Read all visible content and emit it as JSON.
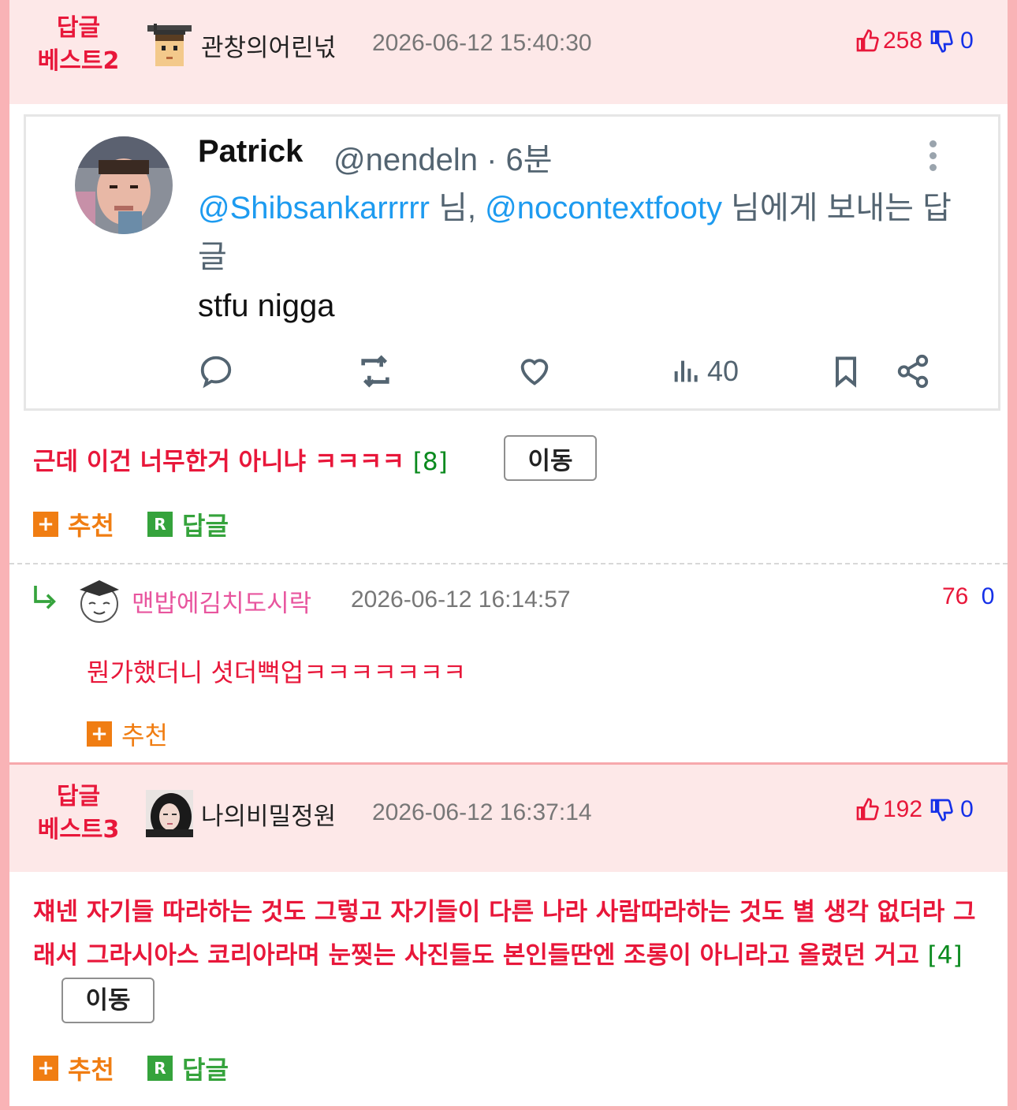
{
  "post1": {
    "best_label_line1": "답글",
    "best_label_line2": "베스트2",
    "nickname": "관창의어린넋",
    "date": "2026-06-12 15:40:30",
    "upvotes": "258",
    "downvotes": "0",
    "tweet": {
      "name": "Patrick",
      "handle": "@nendeln · 6분",
      "mention1": "@Shibsankarrrrr",
      "mention_sep": " 님, ",
      "mention2": "@nocontextfooty",
      "reply_suffix": " 님에게 보내는 답글",
      "text": "stfu nigga",
      "views": "40"
    },
    "comment": "근데 이건 너무한거 아니냐 ㅋㅋㅋㅋ",
    "reply_count": "[8]",
    "move_label": "이동",
    "recommend_label": "추천",
    "reply_label": "답글"
  },
  "sub_reply": {
    "nickname": "맨밥에김치도시락",
    "date": "2026-06-12 16:14:57",
    "upvotes": "76",
    "downvotes": "0",
    "text": "뭔가했더니 셧더뻑업ㅋㅋㅋㅋㅋㅋㅋ",
    "recommend_label": "추천"
  },
  "post2": {
    "best_label_line1": "답글",
    "best_label_line2": "베스트3",
    "nickname": "나의비밀정원",
    "date": "2026-06-12 16:37:14",
    "upvotes": "192",
    "downvotes": "0",
    "comment": "쟤넨 자기들 따라하는 것도 그렇고 자기들이 다른 나라 사람따라하는 것도 별 생각 없더라 그래서 그라시아스 코리아라며 눈찢는 사진들도 본인들딴엔 조롱이 아니라고 올렸던 거고",
    "reply_count": "[4]",
    "move_label": "이동",
    "recommend_label": "추천",
    "reply_label": "답글"
  },
  "colors": {
    "border_pink": "#f9b3b6",
    "header_bg": "#fde8e8",
    "accent_red": "#e8173a",
    "down_blue": "#1530e8",
    "reply_green": "#0a8a1e",
    "recommend_orange": "#f07d12"
  }
}
